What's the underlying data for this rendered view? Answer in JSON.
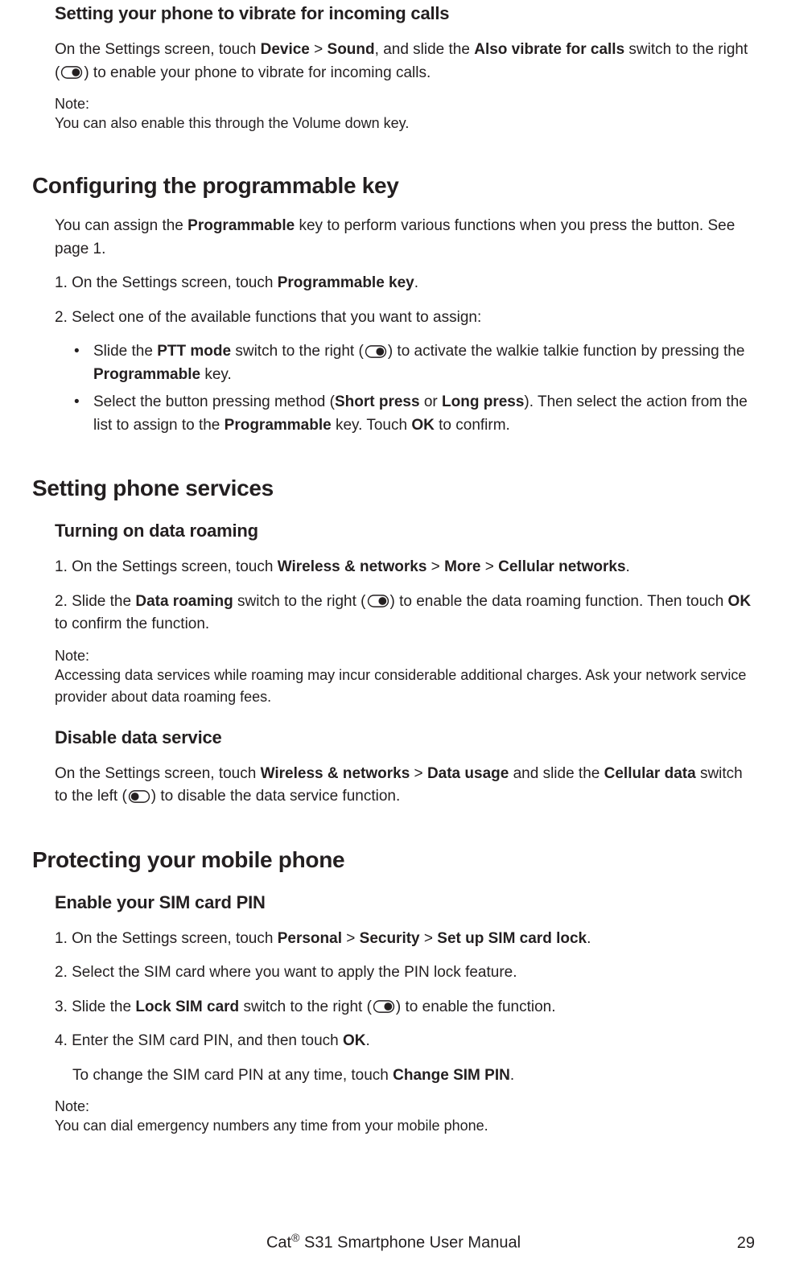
{
  "section1": {
    "heading": "Setting your phone to vibrate for incoming calls",
    "para_pre": "On the Settings screen, touch ",
    "para_bold1": "Device",
    "para_mid1": " > ",
    "para_bold2": "Sound",
    "para_mid2": ", and slide the ",
    "para_bold3": "Also vibrate for calls",
    "para_mid3": " switch to the right (",
    "para_post": ") to enable your phone to vibrate for incoming calls.",
    "note_label": "Note:",
    "note_pre": "You can also enable this through the ",
    "note_bold": "Volume down",
    "note_post": " key."
  },
  "section2": {
    "heading": "Configuring the programmable key",
    "intro_pre": "You can assign the ",
    "intro_bold": "Programmable",
    "intro_post": " key to perform various functions when you press the button. See page 1.",
    "step1_pre": "1. On the Settings screen, touch ",
    "step1_bold": "Programmable key",
    "step1_post": ".",
    "step2": "2. Select one of the available functions that you want to assign:",
    "bullet1_pre": "Slide the ",
    "bullet1_bold1": "PTT mode",
    "bullet1_mid1": " switch to the right (",
    "bullet1_mid2": ") to activate the walkie talkie function by pressing the ",
    "bullet1_bold2": "Programmable",
    "bullet1_post": " key.",
    "bullet2_pre": "Select the button pressing method (",
    "bullet2_bold1": "Short press",
    "bullet2_mid1": " or ",
    "bullet2_bold2": "Long press",
    "bullet2_mid2": "). Then select the action from the list to assign to the ",
    "bullet2_bold3": "Programmable",
    "bullet2_mid3": " key. Touch ",
    "bullet2_bold4": "OK",
    "bullet2_post": " to confirm."
  },
  "section3": {
    "heading": "Setting phone services",
    "sub1_heading": "Turning on data roaming",
    "s1_step1_pre": "1. On the Settings screen, touch ",
    "s1_step1_bold1": "Wireless & networks",
    "s1_step1_mid1": " > ",
    "s1_step1_bold2": "More",
    "s1_step1_mid2": " > ",
    "s1_step1_bold3": "Cellular networks",
    "s1_step1_post": ".",
    "s1_step2_pre": "2. Slide the ",
    "s1_step2_bold1": "Data roaming",
    "s1_step2_mid1": " switch to the right (",
    "s1_step2_mid2": ") to enable the data roaming function. Then touch ",
    "s1_step2_bold2": "OK",
    "s1_step2_post": " to confirm the function.",
    "s1_note_label": "Note:",
    "s1_note_body": "Accessing data services while roaming may incur considerable additional charges. Ask your network service provider about data roaming fees.",
    "sub2_heading": "Disable data service",
    "s2_para_pre": "On the Settings screen, touch ",
    "s2_para_bold1": "Wireless & networks",
    "s2_para_mid1": " > ",
    "s2_para_bold2": "Data usage",
    "s2_para_mid2": " and slide the ",
    "s2_para_bold3": "Cellular data",
    "s2_para_mid3": " switch to the left (",
    "s2_para_post": ") to disable the data service function."
  },
  "section4": {
    "heading": "Protecting your mobile phone",
    "sub1_heading": "Enable your SIM card PIN",
    "step1_pre": "1. On the Settings screen, touch ",
    "step1_bold1": "Personal",
    "step1_mid1": " > ",
    "step1_bold2": "Security",
    "step1_mid2": " > ",
    "step1_bold3": "Set up SIM card lock",
    "step1_post": ".",
    "step2": "2. Select the SIM card where you want to apply the PIN lock feature.",
    "step3_pre": "3. Slide the ",
    "step3_bold1": "Lock SIM card",
    "step3_mid1": " switch to the right (",
    "step3_post": ") to enable the function.",
    "step4_pre": "4. Enter the SIM card PIN, and then touch ",
    "step4_bold": "OK",
    "step4_post": ".",
    "step4_sub_pre": "To change the SIM card PIN at any time, touch ",
    "step4_sub_bold": "Change SIM PIN",
    "step4_sub_post": ".",
    "note_label": "Note:",
    "note_body": "You can dial emergency numbers any time from your mobile phone."
  },
  "footer": {
    "brand_pre": "Cat",
    "brand_sup": "®",
    "brand_post": " S31 Smartphone User Manual",
    "page": "29"
  }
}
